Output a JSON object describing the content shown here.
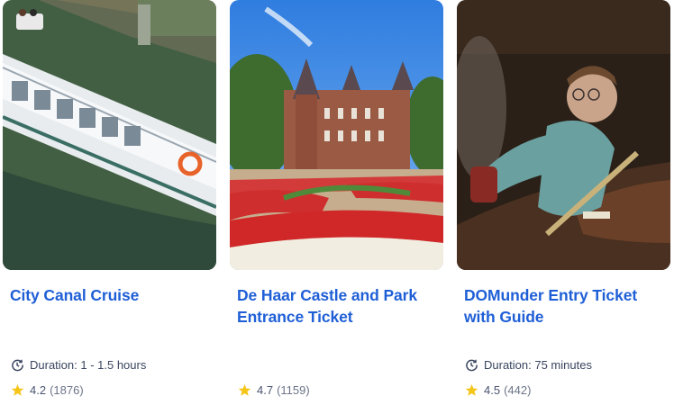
{
  "cards": [
    {
      "title": "City Canal Cruise",
      "duration": "Duration: 1 - 1.5 hours",
      "rating": "4.2",
      "reviews": "(1876)",
      "image_subject": "canal-boat"
    },
    {
      "title": "De Haar Castle and Park Entrance Ticket",
      "duration": "",
      "rating": "4.7",
      "reviews": "(1159)",
      "image_subject": "castle-garden"
    },
    {
      "title": "DOMunder Entry Ticket with Guide",
      "duration": "Duration: 75 minutes",
      "rating": "4.5",
      "reviews": "(442)",
      "image_subject": "underground-visitor"
    }
  ],
  "icons": {
    "duration": "clock-icon",
    "rating": "star-icon"
  },
  "colors": {
    "title": "#1f5fd6",
    "star": "#f5c518",
    "text": "#3b4660"
  }
}
